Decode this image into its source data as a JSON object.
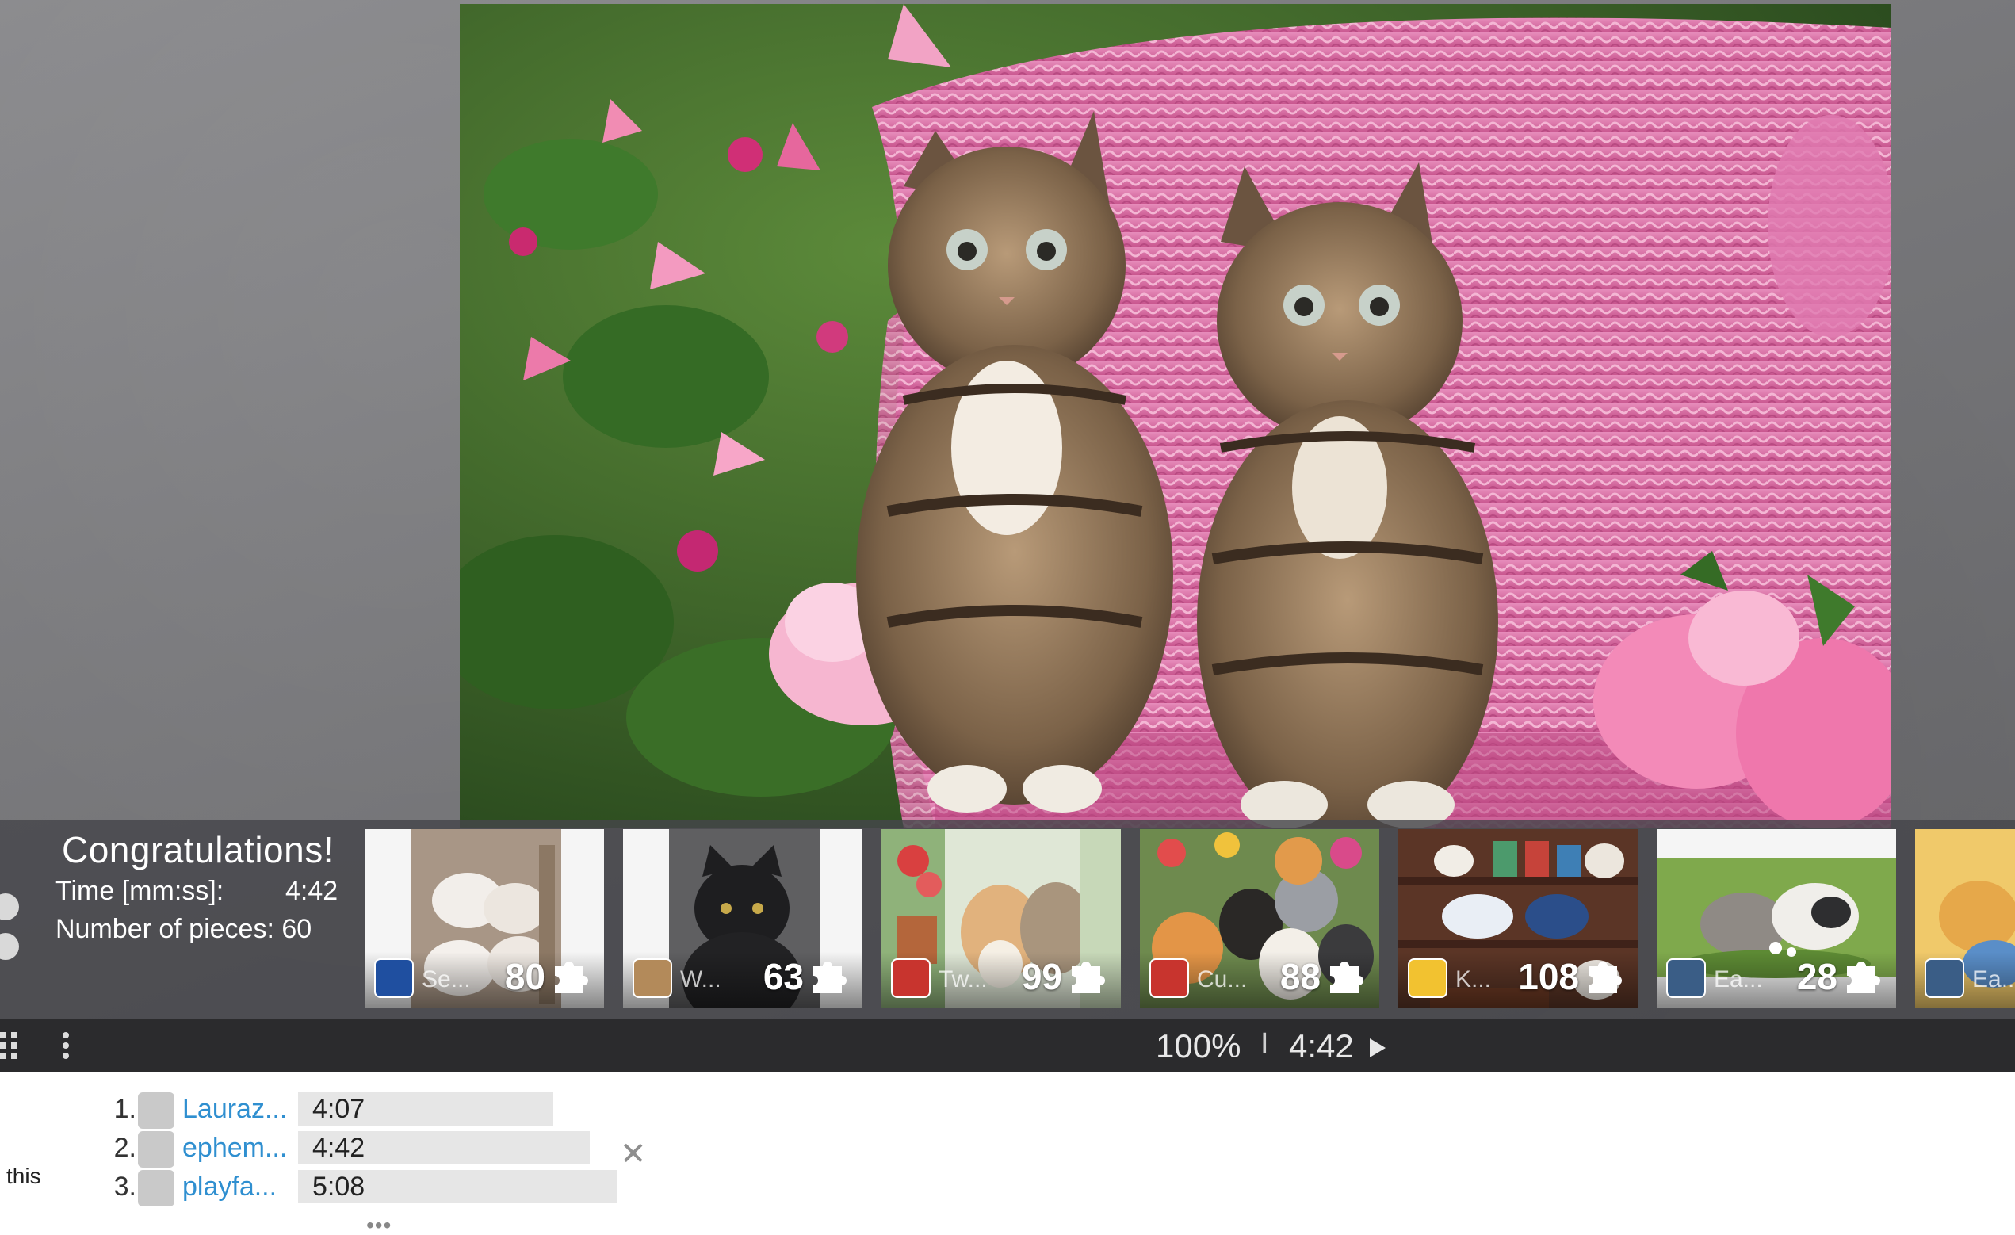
{
  "puzzle": {
    "subject": "two tabby kittens on a pink wicker chair with pink flowers"
  },
  "congrats": {
    "title": "Congratulations!",
    "time_label": "Time [mm:ss]:",
    "time_value": "4:42",
    "pieces_label": "Number of pieces: 60"
  },
  "thumbnails": [
    {
      "user": "Se...",
      "count": "80",
      "avatar_color": "#1f4fa0"
    },
    {
      "user": "W...",
      "count": "63",
      "avatar_color": "#b38a5a"
    },
    {
      "user": "Tw...",
      "count": "99",
      "avatar_color": "#c8342e"
    },
    {
      "user": "Cu...",
      "count": "88",
      "avatar_color": "#c8342e"
    },
    {
      "user": "K...",
      "count": "108",
      "avatar_color": "#f2c230"
    },
    {
      "user": "Ea...",
      "count": "28",
      "avatar_color": "#3a5d86"
    },
    {
      "user": "Ea...",
      "count": "",
      "avatar_color": "#3a5d86"
    }
  ],
  "toolbar": {
    "zoom": "100%",
    "separator": "I",
    "timer": "4:42"
  },
  "leaderboard": {
    "rows": [
      {
        "rank": "1.",
        "name": "Lauraz...",
        "time": "4:07"
      },
      {
        "rank": "2.",
        "name": "ephem...",
        "time": "4:42"
      },
      {
        "rank": "3.",
        "name": "playfa...",
        "time": "5:08"
      }
    ],
    "close_symbol": "✕",
    "side_text": "this",
    "more": "•••"
  },
  "colors": {
    "link": "#2f8fd0",
    "toolbar_bg": "#2b2b2d",
    "strip_bg": "#46464a"
  }
}
